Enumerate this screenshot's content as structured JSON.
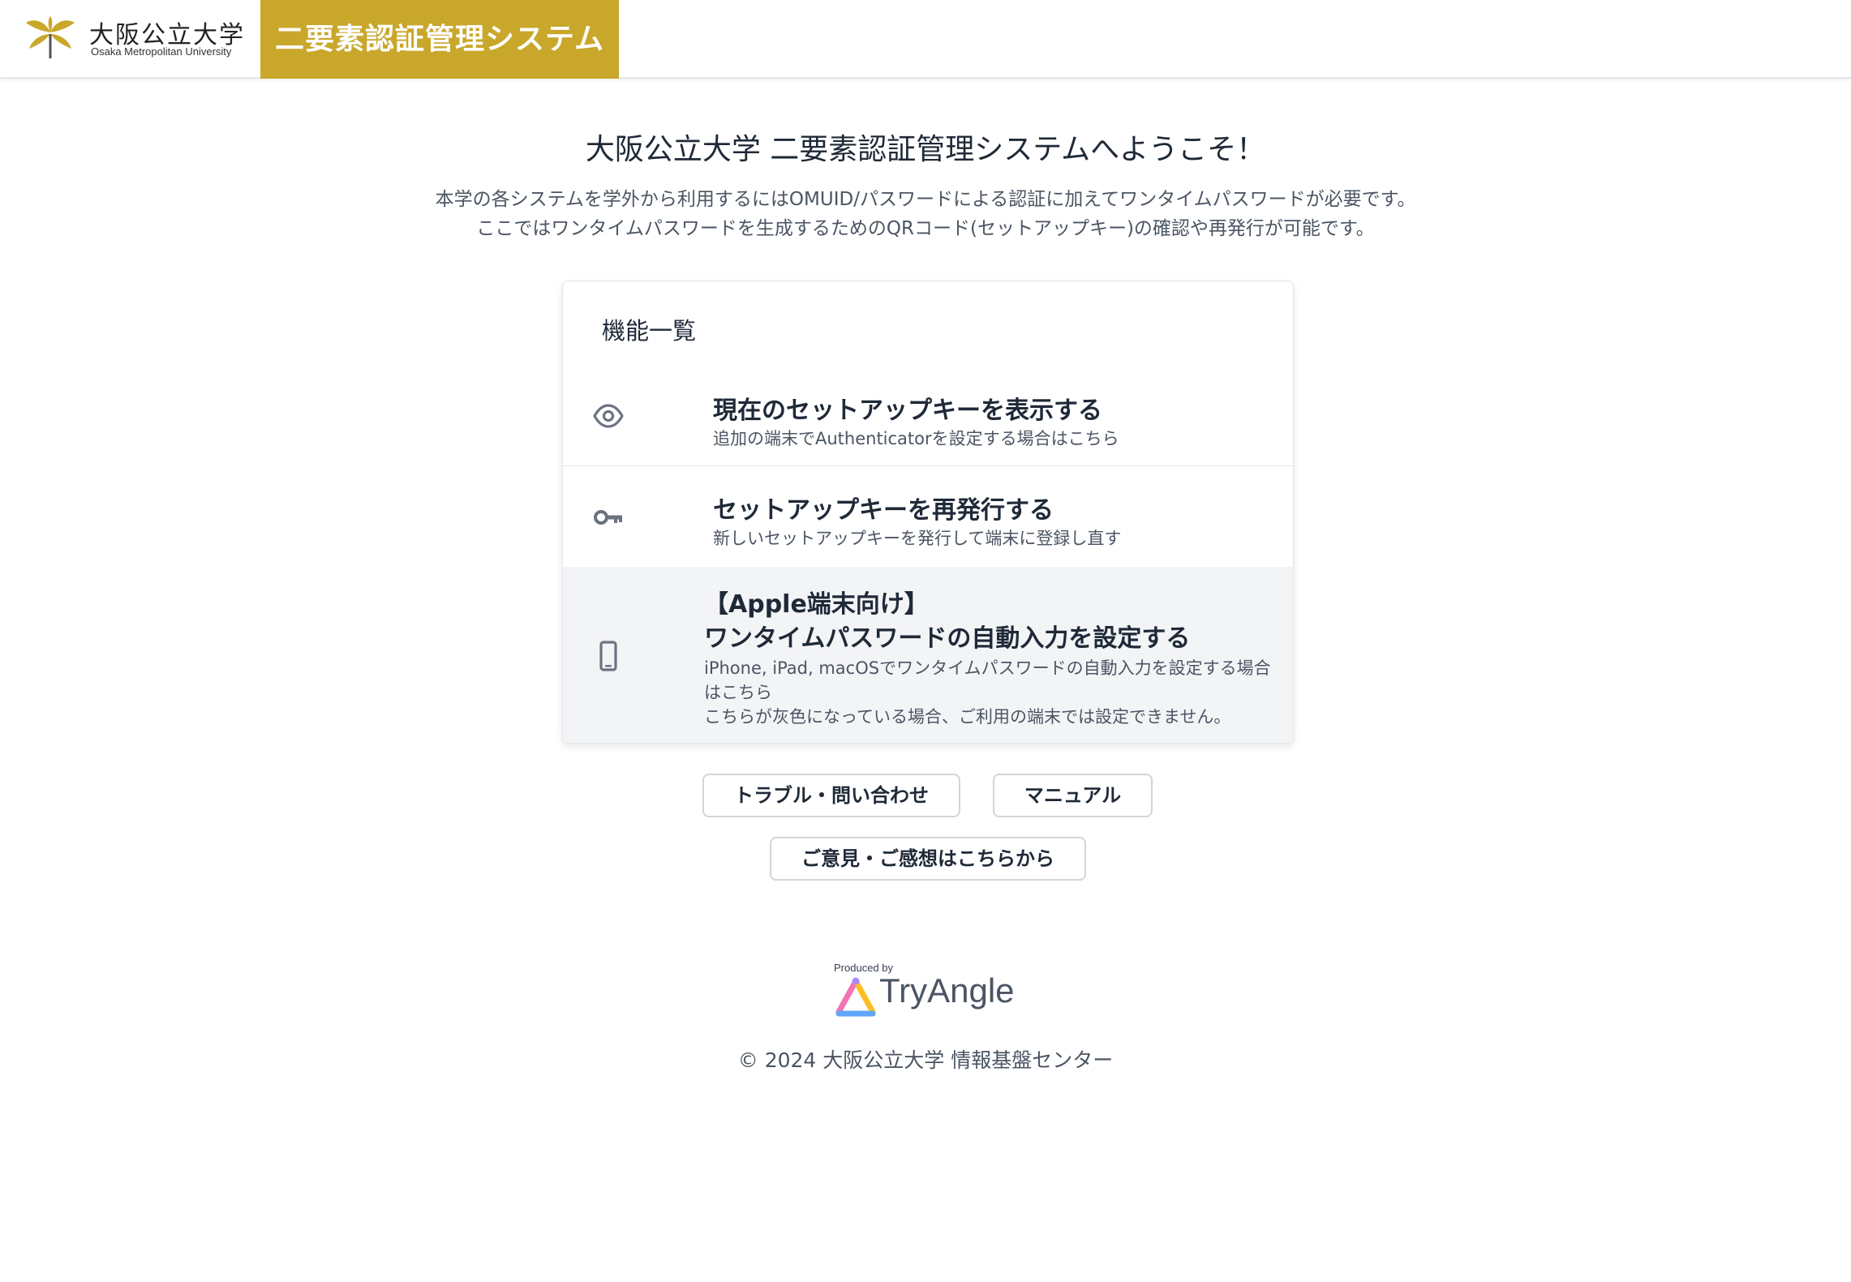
{
  "header": {
    "logo_name": "大阪公立大学",
    "logo_en": "Osaka Metropolitan University",
    "system_title": "二要素認証管理システム"
  },
  "intro": {
    "welcome": "大阪公立大学 二要素認証管理システムへようこそ！",
    "line1": "本学の各システムを学外から利用するにはOMUID/パスワードによる認証に加えてワンタイムパスワードが必要です。",
    "line2": "ここではワンタイムパスワードを生成するためのQRコード(セットアップキー)の確認や再発行が可能です。"
  },
  "features": {
    "title": "機能一覧",
    "items": [
      {
        "icon": "eye-icon",
        "title": "現在のセットアップキーを表示する",
        "subtitle": "追加の端末でAuthenticatorを設定する場合はこちら"
      },
      {
        "icon": "key-icon",
        "title": "セットアップキーを再発行する",
        "subtitle": "新しいセットアップキーを発行して端末に登録し直す"
      },
      {
        "icon": "smartphone-icon",
        "title_line1": "【Apple端末向け】",
        "title_line2": "ワンタイムパスワードの自動入力を設定する",
        "subtitle_line1": "iPhone, iPad, macOSでワンタイムパスワードの自動入力を設定する場合はこちら",
        "subtitle_line2": "こちらが灰色になっている場合、ご利用の端末では設定できません。"
      }
    ]
  },
  "buttons": {
    "trouble": "トラブル・問い合わせ",
    "manual": "マニュアル",
    "feedback": "ご意見・ご感想はこちらから"
  },
  "footer": {
    "produced_by": "Produced by",
    "brand": "TryAngle",
    "copyright": "© 2024 大阪公立大学 情報基盤センター"
  },
  "colors": {
    "brand_gold": "#c9a72b",
    "text_dark": "#1f2937",
    "text_muted": "#4b5563",
    "disabled_bg": "#f3f4f6"
  }
}
